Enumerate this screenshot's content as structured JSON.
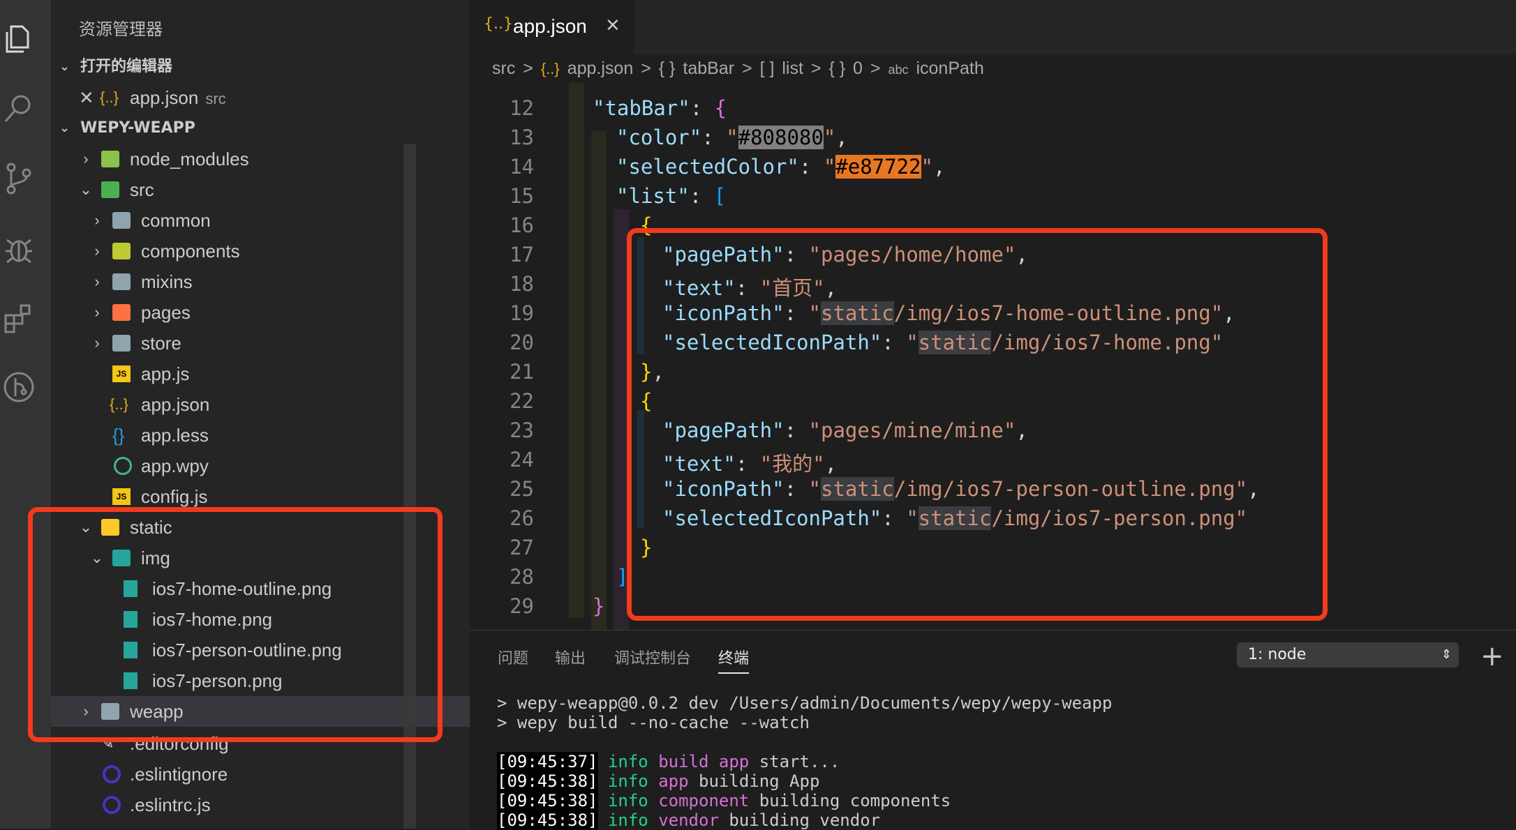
{
  "explorer": {
    "title": "资源管理器",
    "open_editors": {
      "header": "打开的编辑器",
      "items": [
        {
          "name": "app.json",
          "dir": "src"
        }
      ]
    },
    "project": {
      "header": "WEPY-WEAPP",
      "tree": [
        {
          "label": "node_modules"
        },
        {
          "label": "src"
        },
        {
          "label": "common"
        },
        {
          "label": "components"
        },
        {
          "label": "mixins"
        },
        {
          "label": "pages"
        },
        {
          "label": "store"
        },
        {
          "label": "app.js"
        },
        {
          "label": "app.json"
        },
        {
          "label": "app.less"
        },
        {
          "label": "app.wpy"
        },
        {
          "label": "config.js"
        },
        {
          "label": "static"
        },
        {
          "label": "img"
        },
        {
          "label": "ios7-home-outline.png"
        },
        {
          "label": "ios7-home.png"
        },
        {
          "label": "ios7-person-outline.png"
        },
        {
          "label": "ios7-person.png"
        },
        {
          "label": "weapp"
        },
        {
          "label": ".editorconfig"
        },
        {
          "label": ".eslintignore"
        },
        {
          "label": ".eslintrc.js"
        }
      ]
    }
  },
  "tabs": [
    {
      "label": "app.json",
      "icon": "json-icon"
    }
  ],
  "breadcrumb": {
    "parts": [
      "src",
      "app.json",
      "tabBar",
      "list",
      "0",
      "iconPath"
    ],
    "seps": [
      ">",
      ">",
      ">",
      ">",
      ">"
    ],
    "icons": [
      "{..}",
      "{ }",
      "[ ]",
      "{ }",
      "abc"
    ]
  },
  "editor": {
    "line_numbers": [
      "12",
      "13",
      "14",
      "15",
      "16",
      "17",
      "18",
      "19",
      "20",
      "21",
      "22",
      "23",
      "24",
      "25",
      "26",
      "27",
      "28",
      "29"
    ],
    "strings": {
      "tabBar": "\"tabBar\"",
      "color": "\"color\"",
      "color_val": "#808080",
      "selectedColor": "\"selectedColor\"",
      "selectedColor_val": "#e87722",
      "list": "\"list\"",
      "pagePath": "\"pagePath\"",
      "text": "\"text\"",
      "iconPath": "\"iconPath\"",
      "selectedIconPath": "\"selectedIconPath\"",
      "static": "static",
      "home_page": "\"pages/home/home\"",
      "home_text": "\"首页\"",
      "home_icon_rest": "/img/ios7-home-outline.png\"",
      "home_sel_rest": "/img/ios7-home.png\"",
      "mine_page": "\"pages/mine/mine\"",
      "mine_text": "\"我的\"",
      "mine_icon_rest": "/img/ios7-person-outline.png\"",
      "mine_sel_rest": "/img/ios7-person.png\""
    }
  },
  "panel": {
    "tabs": [
      "问题",
      "输出",
      "调试控制台",
      "终端"
    ],
    "active_tab": "终端",
    "terminal_select": "1: node",
    "lines": {
      "cmd1": "> wepy-weapp@0.0.2 dev /Users/admin/Documents/wepy/wepy-weapp",
      "cmd2": "> wepy build --no-cache --watch",
      "log1": {
        "time": "[09:45:37]",
        "level": "info",
        "tag": "build app",
        "msg": "start..."
      },
      "log2": {
        "time": "[09:45:38]",
        "level": "info",
        "tag": "app",
        "msg": "building App"
      },
      "log3": {
        "time": "[09:45:38]",
        "level": "info",
        "tag": "component",
        "msg": "building components"
      },
      "log4": {
        "time": "[09:45:38]",
        "level": "info",
        "tag": "vendor",
        "msg": "building vendor"
      }
    }
  },
  "colors": {
    "highlight_box": "#f23b1c",
    "color_swatch": "#808080",
    "selected_color_swatch": "#e87722"
  }
}
